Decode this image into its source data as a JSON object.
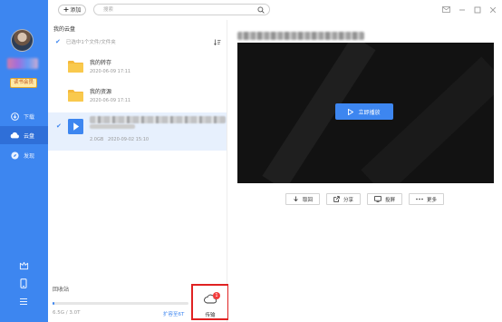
{
  "sidebar": {
    "vip_badge": "读书会员",
    "nav": [
      {
        "label": "下载",
        "icon": "download-icon"
      },
      {
        "label": "云盘",
        "icon": "cloud-icon"
      },
      {
        "label": "发现",
        "icon": "compass-icon"
      }
    ],
    "bottom_icons": [
      "vip-crown-icon",
      "phone-icon",
      "menu-icon"
    ]
  },
  "toolbar": {
    "add_label": "添加",
    "search_placeholder": "搜索"
  },
  "files": {
    "title": "我的云盘",
    "selected_info": "已选中1个文件/文件夹",
    "items": [
      {
        "name": "我的转存",
        "date": "2020-06-09 17:11",
        "type": "folder"
      },
      {
        "name": "我的资源",
        "date": "2020-06-09 17:11",
        "type": "folder"
      },
      {
        "size": "2.0GB",
        "date": "2020-09-02 15:10",
        "type": "video",
        "selected": true
      }
    ]
  },
  "footer": {
    "recycle_label": "回收站",
    "storage": "6.5G / 3.0T",
    "storage_fraction": 0.002,
    "expand_link": "扩容至6T",
    "transfer_label": "传输",
    "transfer_badge": "1"
  },
  "preview": {
    "play_label": "立即播放",
    "actions": [
      {
        "label": "取回",
        "icon": "download-icon"
      },
      {
        "label": "分享",
        "icon": "share-icon"
      },
      {
        "label": "投屏",
        "icon": "cast-icon"
      },
      {
        "label": "更多",
        "icon": "more-icon"
      }
    ]
  },
  "colors": {
    "accent": "#3d86f0",
    "sidebar_bg": "#3d86f0",
    "highlight_border": "#e02222"
  }
}
